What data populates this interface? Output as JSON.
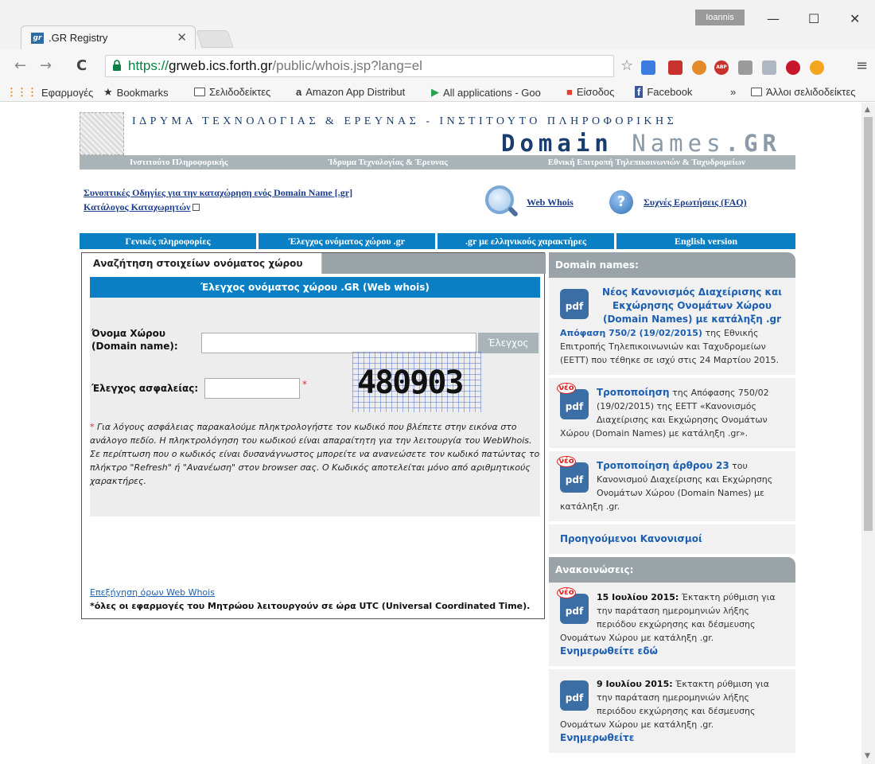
{
  "browser": {
    "tab_title": ".GR Registry",
    "favicon_text": "gr",
    "user": "Ioannis",
    "url_scheme": "https://",
    "url_host": "grweb.ics.forth.gr",
    "url_path": "/public/whois.jsp?lang=el",
    "bookmarks": [
      "Εφαρμογές",
      "Bookmarks",
      "Σελιδοδείκτες",
      "Amazon App Distribut",
      "All applications - Goo",
      "Είσοδος",
      "Facebook",
      "»",
      "Άλλοι σελιδοδείκτες"
    ]
  },
  "header": {
    "institute_line": "ΙΔΡΥΜΑ ΤΕΧΝΟΛΟΓΙΑΣ & ΕΡΕΥΝΑΣ - ΙΝΣΤΙΤΟΥΤΟ ΠΛΗΡΟΦΟΡΙΚΗΣ",
    "logo_domain": "Domain",
    "logo_names": "Names",
    "logo_gr": ".GR",
    "strip": [
      "Ινστιτούτο Πληροφορικής",
      "Ίδρυμα Τεχνολογίας & Έρευνας",
      "Εθνική Επιτροπή Τηλεπικοινωνιών & Ταχυδρομείων"
    ]
  },
  "links": {
    "guide": "Συνοπτικές Οδηγίες για την καταχώρηση ενός Domain Name [.gr]",
    "registrars": "Κατάλογος Καταχωρητών",
    "whois": "Web Whois",
    "faq": "Συχνές Ερωτήσεις (FAQ)"
  },
  "nav": [
    "Γενικές πληροφορίες",
    "Έλεγχος ονόματος χώρου .gr",
    ".gr με ελληνικούς χαρακτήρες",
    "English version"
  ],
  "form": {
    "tab": "Αναζήτηση στοιχείων ονόματος χώρου .GR",
    "header": "Έλεγχος ονόματος χώρου .GR (Web whois)",
    "domain_label_1": "Όνομα Χώρου",
    "domain_label_2": "(Domain name):",
    "domain_value": "",
    "check_button": "Έλεγχος",
    "security_label": "Έλεγχος ασφαλείας:",
    "security_value": "",
    "required_mark": "*",
    "captcha_text": "480903",
    "note": "Για λόγους ασφάλειας παρακαλούμε πληκτρολογήστε τον κωδικό που βλέπετε στην εικόνα στο ανάλογο πεδίο. Η πληκτρολόγηση του κωδικού είναι απαραίτητη για την λειτουργία του WebWhois. Σε περίπτωση που ο κωδικός είναι δυσανάγνωστος μπορείτε να ανανεώσετε τον κωδικό πατώντας το πλήκτρο \"Refresh\" ή \"Ανανέωση\" στον browser σας. Ο Κωδικός αποτελείται μόνο από αριθμητικούς χαρακτήρες.",
    "explain_link": "Επεξήγηση όρων Web Whois",
    "utc_note": "*όλες οι εφαρμογές του Μητρώου λειτουργούν σε ώρα UTC (Universal Coordinated Time)."
  },
  "sidebar": {
    "domain_names_header": "Domain names:",
    "item1_title": "Νέος Κανονισμός Διαχείρισης και Εκχώρησης Ονομάτων Χώρου (Domain Names) με κατάληξη .gr",
    "item1_bold": "Απόφαση 750/2 (19/02/2015)",
    "item1_text": " της Εθνικής Επιτροπής Τηλεπικοινωνιών και Ταχυδρομείων (ΕΕΤΤ) που τέθηκε σε ισχύ στις 24 Μαρτίου 2015.",
    "item2_bold": "Τροποποίηση",
    "item2_text": " της Απόφασης 750/02 (19/02/2015) της ΕΕΤΤ «Κανονισμός Διαχείρισης και Εκχώρησης Ονομάτων Χώρου (Domain Names) με κατάληξη .gr».",
    "item3_bold": "Τροποποίηση άρθρου 23",
    "item3_text": " του Κανονισμού Διαχείρισης και Εκχώρησης Ονομάτων Χώρου (Domain Names) με κατάληξη .gr.",
    "previous": "Προηγούμενοι Κανονισμοί",
    "announcements_header": "Ανακοινώσεις:",
    "ann1_date": "15 Ιουλίου 2015:",
    "ann1_text": " Έκτακτη ρύθμιση για την παράταση ημερομηνιών λήξης περιόδου εκχώρησης και δέσμευσης Ονομάτων Χώρου με κατάληξη .gr.",
    "ann1_link": "Ενημερωθείτε εδώ",
    "ann2_date": "9 Ιουλίου 2015:",
    "ann2_text": " Έκτακτη ρύθμιση για την παράταση ημερομηνιών λήξης περιόδου εκχώρησης και δέσμευσης Ονομάτων Χώρου με κατάληξη .gr.",
    "ann2_link": "Ενημερωθείτε",
    "pdf_label": "pdf",
    "new_label": "νέο"
  }
}
